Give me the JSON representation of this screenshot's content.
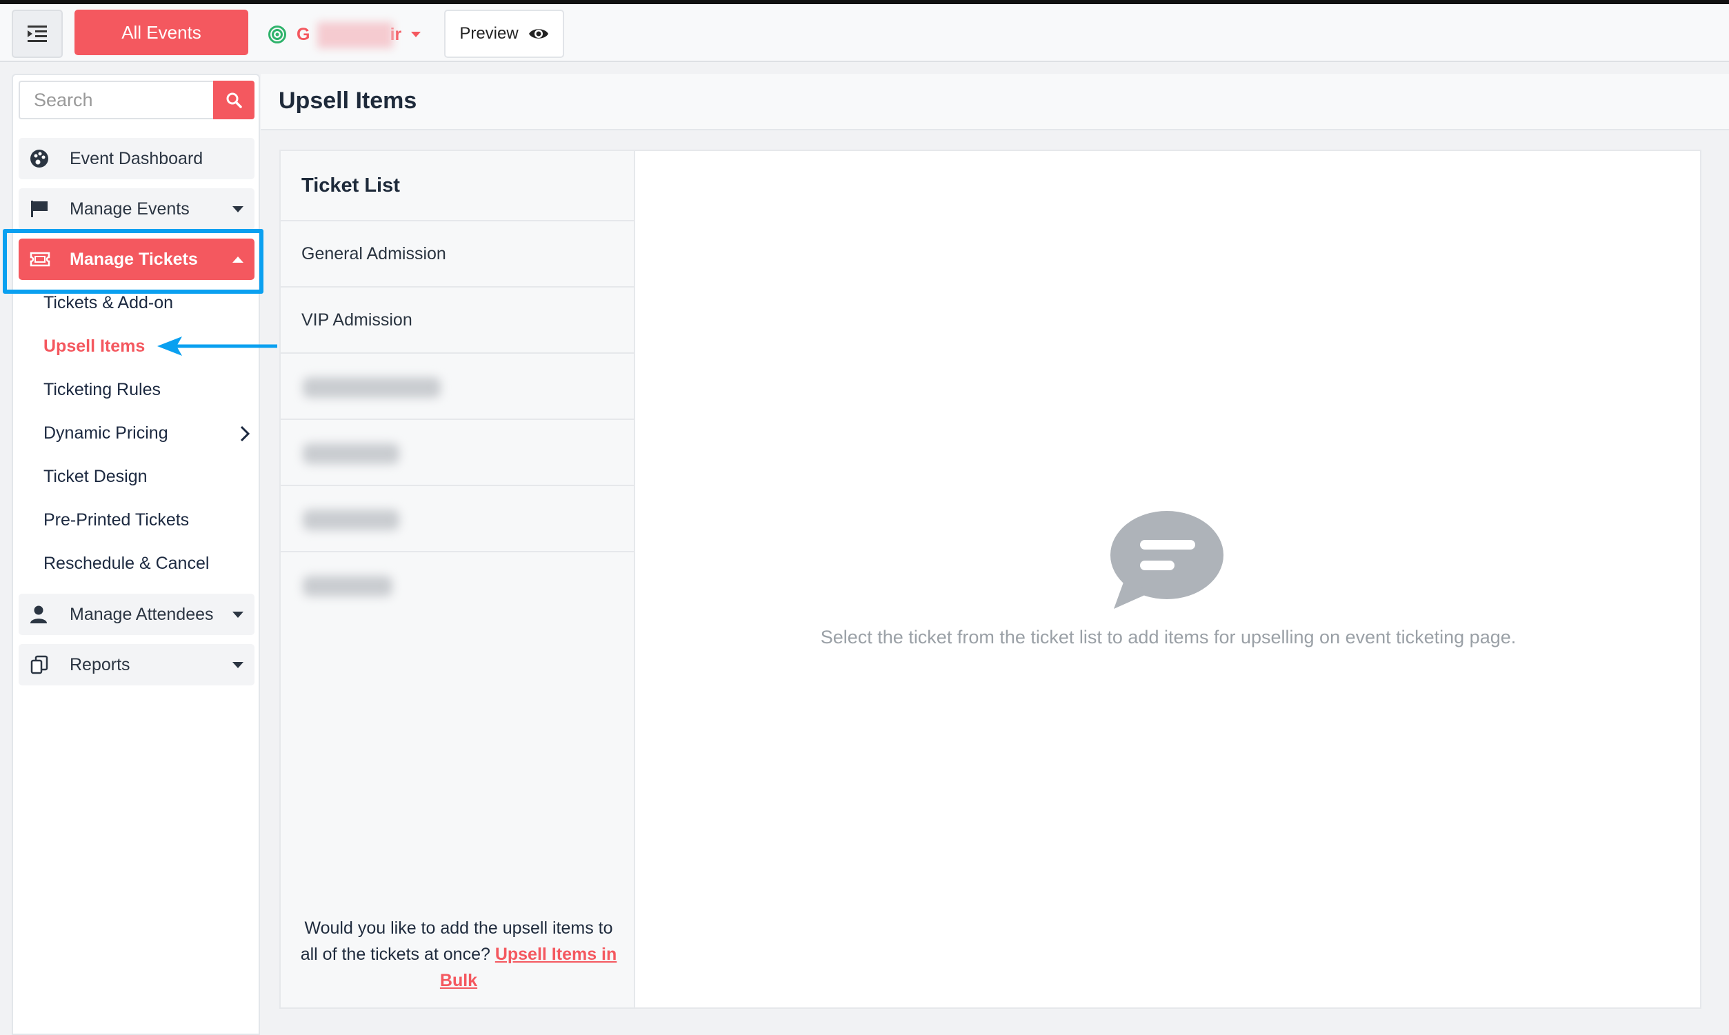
{
  "topbar": {
    "all_events_label": "All Events",
    "event_name_start": "G",
    "event_name_end": "ir",
    "preview_label": "Preview"
  },
  "sidebar": {
    "search_placeholder": "Search",
    "nav": {
      "event_dashboard": "Event Dashboard",
      "manage_events": "Manage Events",
      "manage_tickets": "Manage Tickets",
      "manage_attendees": "Manage Attendees",
      "reports": "Reports"
    },
    "sub_items": [
      "Tickets & Add-on",
      "Upsell Items",
      "Ticketing Rules",
      "Dynamic Pricing",
      "Ticket Design",
      "Pre-Printed Tickets",
      "Reschedule & Cancel"
    ]
  },
  "page": {
    "title": "Upsell Items"
  },
  "ticket_list": {
    "heading": "Ticket List",
    "rows": [
      "General Admission",
      "VIP Admission"
    ],
    "footer_text": "Would you like to add the upsell items to all of the tickets at once? ",
    "footer_link": "Upsell Items in Bulk"
  },
  "empty_state": {
    "message": "Select the ticket from the ticket list to add items for upselling on event ticketing page."
  },
  "colors": {
    "accent": "#f4585f",
    "highlight": "#0aa0f0",
    "status_green": "#2fb36b"
  }
}
